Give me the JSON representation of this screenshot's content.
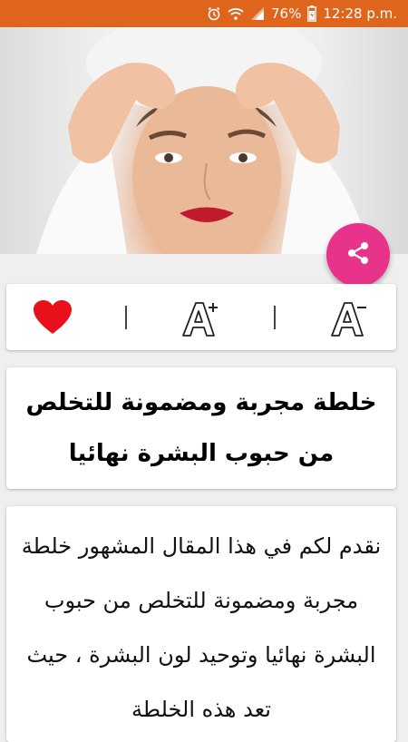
{
  "status_bar": {
    "battery_percent": "76%",
    "time": "12:28 p.m.",
    "icons": [
      "alarm-icon",
      "wifi-icon",
      "signal-icon",
      "battery-icon"
    ],
    "background": "#e0651c"
  },
  "hero": {
    "alt": "woman-squeezing-pimple"
  },
  "share_button": {
    "icon": "share-icon",
    "color": "#e8338a"
  },
  "actions": {
    "favorite_icon": "heart-icon",
    "increase_font_icon": "font-increase-icon",
    "decrease_font_icon": "font-decrease-icon",
    "favorite_color": "#e8101a"
  },
  "article": {
    "title": "خلطة مجربة ومضمونة للتخلص من حبوب البشرة نهائيا",
    "body": "نقدم لكم في هذا المقال المشهور خلطة مجربة ومضمونة للتخلص من حبوب البشرة نهائيا وتوحيد لون البشرة ، حيث تعد هذه الخلطة"
  }
}
